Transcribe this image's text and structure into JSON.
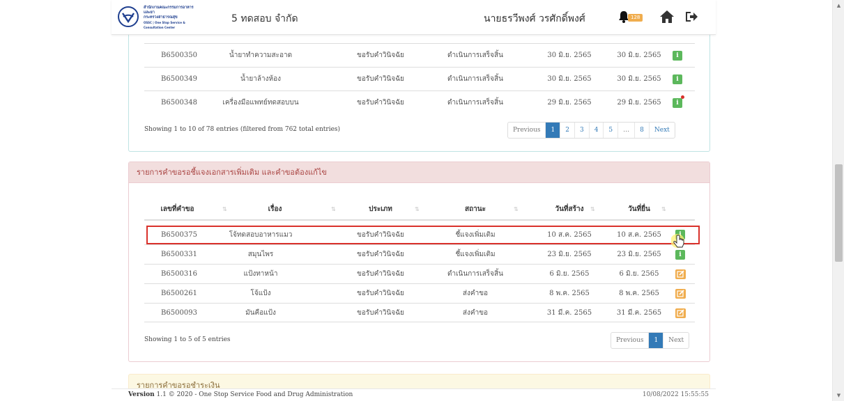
{
  "header": {
    "logo_line1": "สำนักงานคณะกรรมการอาหารและยา",
    "logo_line2": "กระทรวงสาธารณสุข",
    "logo_line3": "OSSC | One Stop Service & Consultation Center",
    "company": "5 ทดสอบ จำกัด",
    "username": "นายธรวีพงศ์ วรศักดิ์พงศ์",
    "notification_count": "128"
  },
  "table1": {
    "rows": [
      {
        "id": "B6500350",
        "subject": "น้ำยาทำความสะอาด",
        "type": "ขอรับคำวินิจฉัย",
        "status": "ดำเนินการเสร็จสิ้น",
        "created": "30 มิ.ย. 2565",
        "submitted": "30 มิ.ย. 2565",
        "action": "info"
      },
      {
        "id": "B6500349",
        "subject": "น้ำยาล้างห้อง",
        "type": "ขอรับคำวินิจฉัย",
        "status": "ดำเนินการเสร็จสิ้น",
        "created": "30 มิ.ย. 2565",
        "submitted": "30 มิ.ย. 2565",
        "action": "info"
      },
      {
        "id": "B6500348",
        "subject": "เครื่องมือแพทย์ทดสอบบน",
        "type": "ขอรับคำวินิจฉัย",
        "status": "ดำเนินการเสร็จสิ้น",
        "created": "29 มิ.ย. 2565",
        "submitted": "29 มิ.ย. 2565",
        "action": "info"
      }
    ],
    "info": "Showing 1 to 10 of 78 entries (filtered from 762 total entries)",
    "pagination": [
      "Previous",
      "1",
      "2",
      "3",
      "4",
      "5",
      "…",
      "8",
      "Next"
    ]
  },
  "panel2": {
    "title": "รายการคำขอรอชี้แจงเอกสารเพิ่มเติม และคำขอต้องแก้ไข",
    "headers": [
      "เลขที่คำขอ",
      "เรื่อง",
      "ประเภท",
      "สถานะ",
      "วันที่สร้าง",
      "วันที่ยื่น"
    ],
    "rows": [
      {
        "id": "B6500375",
        "subject": "โจ้ทดสอบอาหารแมว",
        "type": "ขอรับคำวินิจฉัย",
        "status": "ชี้แจงเพิ่มเติม",
        "created": "10 ส.ค. 2565",
        "submitted": "10 ส.ค. 2565",
        "action": "info"
      },
      {
        "id": "B6500331",
        "subject": "สมุนไพร",
        "type": "ขอรับคำวินิจฉัย",
        "status": "ชี้แจงเพิ่มเติม",
        "created": "23 มิ.ย. 2565",
        "submitted": "23 มิ.ย. 2565",
        "action": "info"
      },
      {
        "id": "B6500316",
        "subject": "แป้งทาหน้า",
        "type": "ขอรับคำวินิจฉัย",
        "status": "ดำเนินการเสร็จสิ้น",
        "created": "6 มิ.ย. 2565",
        "submitted": "6 มิ.ย. 2565",
        "action": "edit"
      },
      {
        "id": "B6500261",
        "subject": "โจ้แป้ง",
        "type": "ขอรับคำวินิจฉัย",
        "status": "ส่งคำขอ",
        "created": "8 พ.ค. 2565",
        "submitted": "8 พ.ค. 2565",
        "action": "edit"
      },
      {
        "id": "B6500093",
        "subject": "มันคือแป้ง",
        "type": "ขอรับคำวินิจฉัย",
        "status": "ส่งคำขอ",
        "created": "31 มี.ค. 2565",
        "submitted": "31 มี.ค. 2565",
        "action": "edit"
      }
    ],
    "info": "Showing 1 to 5 of 5 entries",
    "pagination": [
      "Previous",
      "1",
      "Next"
    ]
  },
  "panel3": {
    "title": "รายการคำขอรอชำระเงิน"
  },
  "footer": {
    "version_label": "Version",
    "version_text": "1.1 © 2020 - One Stop Service Food and Drug Administration",
    "datetime": "10/08/2022 15:55:55"
  },
  "colors": {
    "info_green": "#5cb85c",
    "edit_orange": "#f0ad4e",
    "pager_blue": "#337ab7",
    "danger_head": "#f2dede",
    "highlight_red": "#d9312b"
  }
}
